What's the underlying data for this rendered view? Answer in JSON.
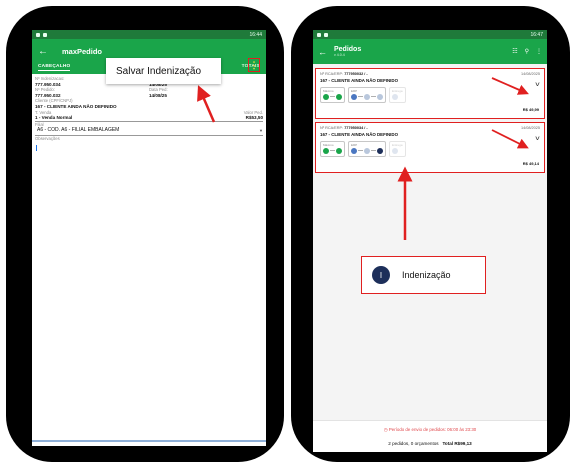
{
  "left_screen": {
    "status_time": "16:44",
    "app_title": "maxPedido",
    "back_icon": "arrow-left-icon",
    "menu_icon": "more-vert-icon",
    "tabs": [
      {
        "label": "CABEÇALHO",
        "active": true
      },
      {
        "label": "TABELA",
        "active": false
      },
      {
        "label": "PRODUTOS",
        "active": false
      },
      {
        "label": "TOTAIS",
        "active": false
      }
    ],
    "popup_label": "Salvar Indenização",
    "form": {
      "indenizacao_label": "Nº Indenizacao:",
      "indenizacao_value": "777.950.034",
      "data_label": "Data:",
      "data_value": "14/08/25",
      "pedido_label": "Nº Pedido:",
      "pedido_value": "777.950.032",
      "data_ped_label": "Data Ped:",
      "data_ped_value": "14/08/25",
      "cliente_label": "Cliente (CPF/CNPJ)",
      "cliente_value": "167 - CLIENTE AINDA NÃO DEFINIDO",
      "tvenda_label": "T. Venda",
      "tvenda_value": "1 - Venda Normal",
      "valor_label": "Valor Ped.",
      "valor_value": "R$53,50",
      "filial_label": "Filial",
      "filial_value": "A6 - COD. A6 - FILIAL EMBALAGEM",
      "obs_label": "Observações"
    }
  },
  "right_screen": {
    "status_time": "16:47",
    "title": "Pedidos",
    "subtitle": "v 4.0.4",
    "orders": [
      {
        "rca_label": "Nº RCA/ERP:",
        "rca_value": "777950032 / -",
        "date": "14/08/2025",
        "client": "167 - CLIENTE AINDA NÃO DEFINIDO",
        "steps": [
          "Máximo",
          "ERP",
          "Entrega"
        ],
        "price": "R$ 49,99"
      },
      {
        "rca_label": "Nº RCA/ERP:",
        "rca_value": "777950034 / -",
        "date": "14/08/2025",
        "client": "167 - CLIENTE AINDA NÃO DEFINIDO",
        "steps": [
          "Máximo",
          "ERP",
          "Entrega"
        ],
        "price": "R$ 49,14"
      }
    ],
    "indenizacao_icon_letter": "I",
    "indenizacao_label": "Indenização",
    "footer_warning": "Período de envio de pedidos: 06:00 às 23:30",
    "footer_summary": "2 pedidos, 0 orçamentos",
    "footer_total": "Total R$99,13"
  },
  "colors": {
    "app_green": "#1aa54a",
    "annotation_red": "#e02020",
    "navy": "#1d2f5a"
  }
}
